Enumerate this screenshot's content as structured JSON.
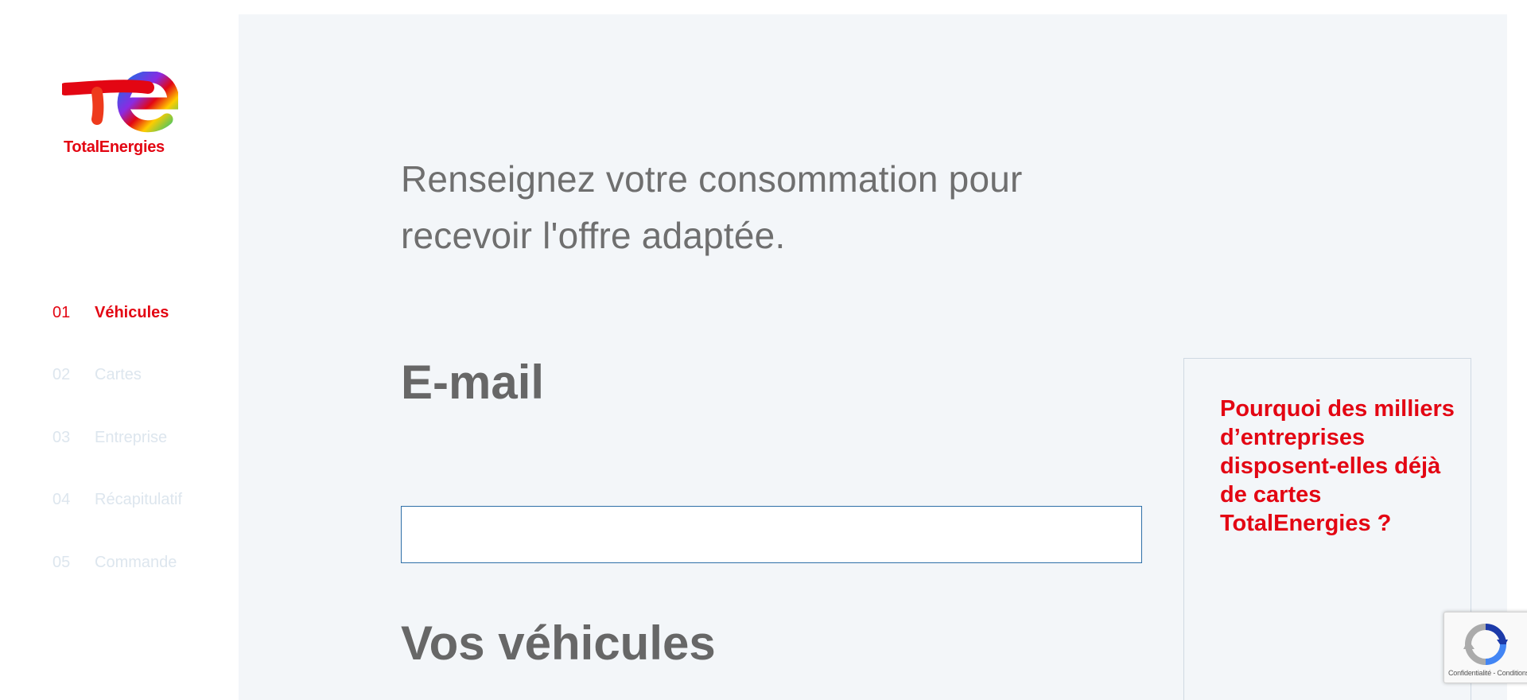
{
  "brand": {
    "name": "TotalEnergies",
    "color": "#e30613"
  },
  "steps": [
    {
      "num": "01",
      "label": "Véhicules",
      "active": true
    },
    {
      "num": "02",
      "label": "Cartes",
      "active": false
    },
    {
      "num": "03",
      "label": "Entreprise",
      "active": false
    },
    {
      "num": "04",
      "label": "Récapitulatif",
      "active": false
    },
    {
      "num": "05",
      "label": "Commande",
      "active": false
    }
  ],
  "main": {
    "intro": "Renseignez votre consommation pour recevoir l'offre adaptée.",
    "email_heading": "E-mail",
    "email_value": "",
    "vehicles_heading": "Vos véhicules"
  },
  "sidebar_box": {
    "title": "Pourquoi des milliers d’entreprises disposent-elles déjà de cartes TotalEnergies ?"
  },
  "recaptcha": {
    "links": "Confidentialité - Conditions"
  },
  "colors": {
    "panel_bg": "#f3f6f9",
    "heading_grey": "#676767",
    "inactive_step": "#dde6ee",
    "input_border": "#2e6fa8"
  }
}
